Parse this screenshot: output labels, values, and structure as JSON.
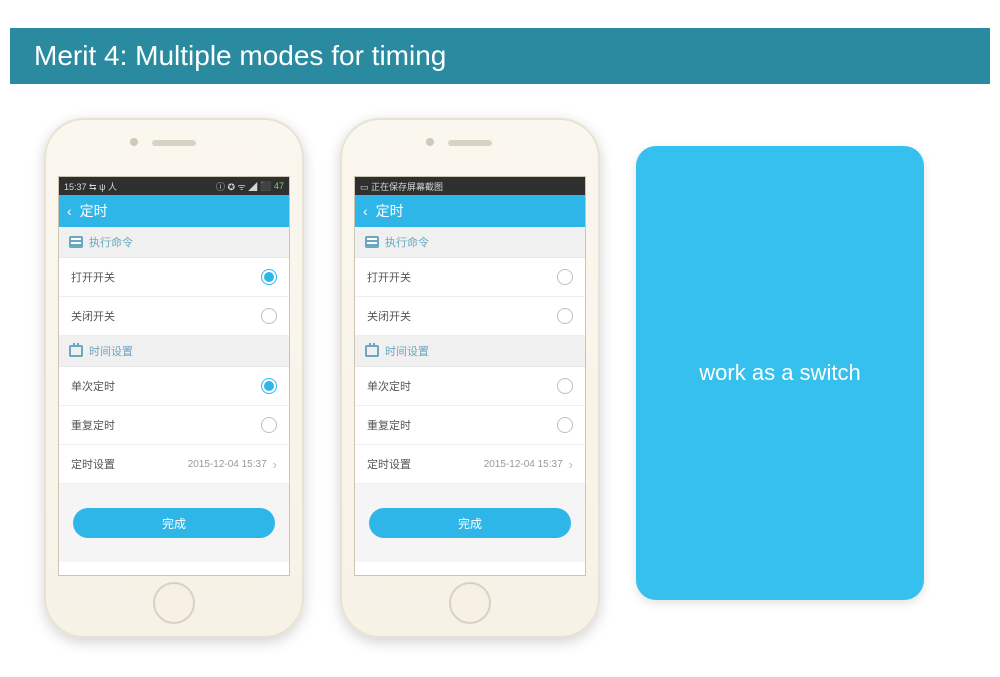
{
  "banner": {
    "title": "Merit 4: Multiple modes for timing"
  },
  "card": {
    "text": "work as a switch"
  },
  "phones": [
    {
      "status_left": "15:37  ⇆  ψ  人",
      "status_right_icons": "ⓘ ✪ ᯤ ◢",
      "status_batt": "⬛ 47",
      "header": {
        "back": "‹",
        "title": "定时"
      },
      "sections": [
        {
          "icon": "cmd",
          "label": "执行命令",
          "items": [
            {
              "label": "打开开关",
              "selected": true
            },
            {
              "label": "关闭开关",
              "selected": false
            }
          ]
        },
        {
          "icon": "cal",
          "label": "时间设置",
          "items": [
            {
              "label": "单次定时",
              "selected": true
            },
            {
              "label": "重复定时",
              "selected": false
            }
          ]
        }
      ],
      "time_row": {
        "label": "定时设置",
        "value": "2015-12-04 15:37"
      },
      "done": "完成"
    },
    {
      "status_left": "▭ 正在保存屏幕截图",
      "status_right_icons": "",
      "status_batt": "",
      "header": {
        "back": "‹",
        "title": "定时"
      },
      "sections": [
        {
          "icon": "cmd",
          "label": "执行命令",
          "items": [
            {
              "label": "打开开关",
              "selected": false
            },
            {
              "label": "关闭开关",
              "selected": false
            }
          ]
        },
        {
          "icon": "cal",
          "label": "时间设置",
          "items": [
            {
              "label": "单次定时",
              "selected": false
            },
            {
              "label": "重复定时",
              "selected": false
            }
          ]
        }
      ],
      "time_row": {
        "label": "定时设置",
        "value": "2015-12-04 15:37"
      },
      "done": "完成"
    }
  ]
}
